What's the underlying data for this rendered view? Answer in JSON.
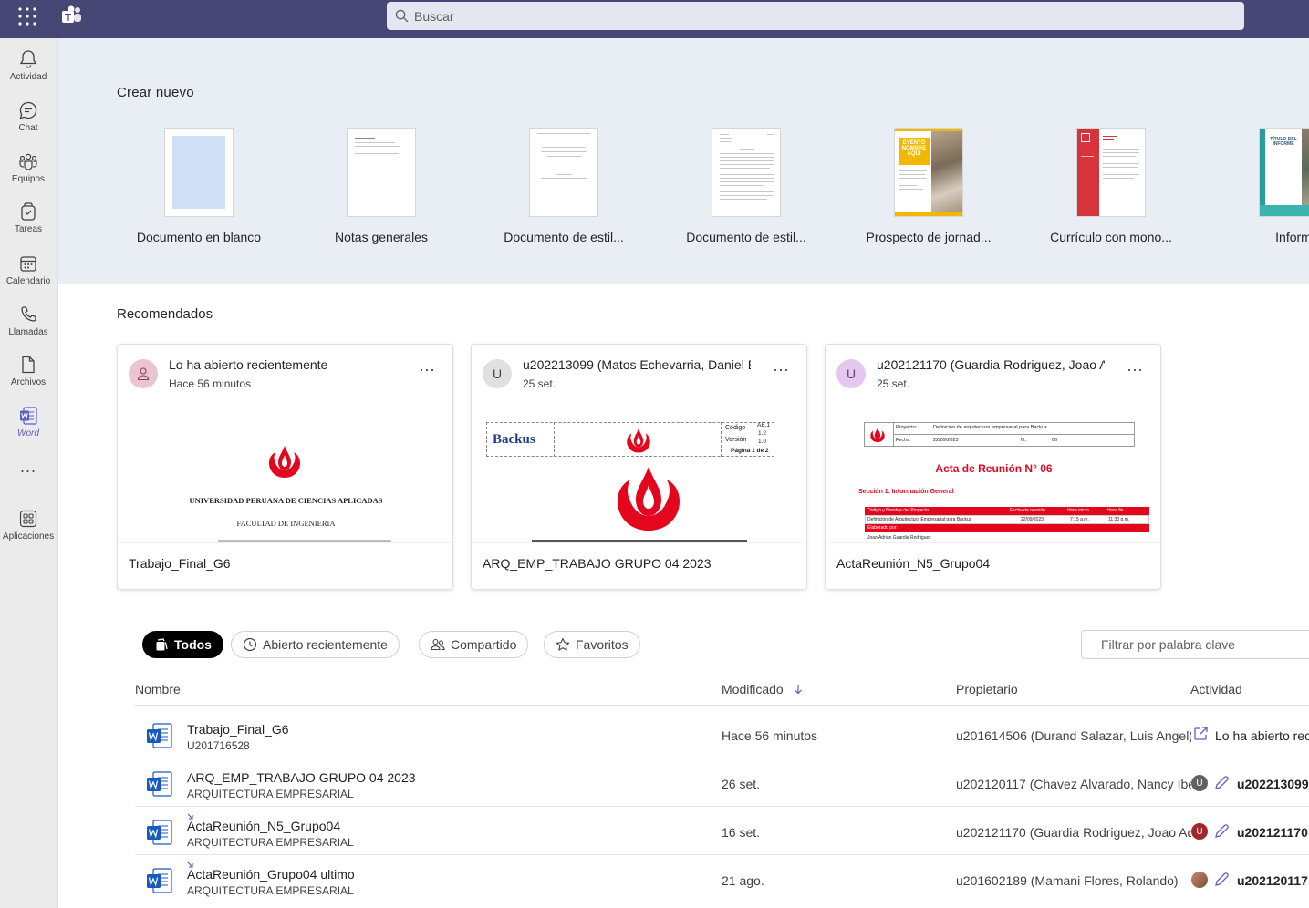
{
  "search": {
    "placeholder": "Buscar"
  },
  "rail": {
    "items": [
      {
        "label": "Actividad",
        "icon": "bell-icon"
      },
      {
        "label": "Chat",
        "icon": "chat-icon"
      },
      {
        "label": "Equipos",
        "icon": "teams-icon"
      },
      {
        "label": "Tareas",
        "icon": "tasks-icon"
      },
      {
        "label": "Calendario",
        "icon": "calendar-icon"
      },
      {
        "label": "Llamadas",
        "icon": "phone-icon"
      },
      {
        "label": "Archivos",
        "icon": "file-icon"
      },
      {
        "label": "Word",
        "icon": "word-icon",
        "active": true
      },
      {
        "label": "Aplicaciones",
        "icon": "apps-icon"
      }
    ],
    "more": "..."
  },
  "create_new": {
    "title": "Crear nuevo",
    "templates": [
      {
        "name": "Documento en blanco"
      },
      {
        "name": "Notas generales"
      },
      {
        "name": "Documento de estil..."
      },
      {
        "name": "Documento de estil..."
      },
      {
        "name": "Prospecto de jornad...",
        "thumb_text": "EVENTO NOMBRE AQUÍ"
      },
      {
        "name": "Currículo con mono..."
      },
      {
        "name": "Inform",
        "thumb_text": "TÍTULO DEL INFORME"
      }
    ]
  },
  "recommended": {
    "title": "Recomendados",
    "cards": [
      {
        "avatar": "",
        "who": "Lo ha abierto recientemente",
        "when": "Hace 56 minutos",
        "file": "Trabajo_Final_G6",
        "preview": {
          "line1": "UNIVERSIDAD PERUANA DE CIENCIAS APLICADAS",
          "line2": "FACULTAD DE INGENIERIA"
        }
      },
      {
        "avatar": "U",
        "who": "u202213099 (Matos Echevarria, Daniel Er",
        "when": "25 set.",
        "file": "ARQ_EMP_TRABAJO GRUPO 04 2023",
        "preview": {
          "brand": "Backus",
          "f1": "Código",
          "f2": "Versión",
          "f3": "Página 1 de 2",
          "v1": "AE.1",
          "v2": "1.2",
          "v3": "1.0"
        }
      },
      {
        "avatar": "U",
        "who": "u202121170 (Guardia Rodriguez, Joao Ad",
        "when": "25 set.",
        "file": "ActaReunión_N5_Grupo04",
        "preview": {
          "heading": "Acta de Reunión N° 06",
          "section": "Sección 1. Información General",
          "k1": "Proyecto:",
          "v1": "Definición de arquitectura empresarial para Backus",
          "k2": "Fecha:",
          "v2": "22/09/2023",
          "k3": "N.:",
          "v3": "06",
          "th1": "Código y Nombre del Proyecto",
          "th2": "Fecha de reunión",
          "th3": "Hora inicio",
          "th4": "Hora fin",
          "td1": "Definición de Arquitectura Empresarial para Backus",
          "td2": "22/09/2023",
          "td3": "7:15 a.m.",
          "td4": "11:30 p.m.",
          "elab": "Elaborado por:",
          "elab_name": "Joao Adrian Guardia Rodriguez"
        }
      }
    ]
  },
  "filters": {
    "chips": [
      {
        "label": "Todos",
        "active": true
      },
      {
        "label": "Abierto recientemente"
      },
      {
        "label": "Compartido"
      },
      {
        "label": "Favoritos"
      }
    ],
    "keyword_placeholder": "Filtrar por palabra clave"
  },
  "table": {
    "headers": {
      "name": "Nombre",
      "modified": "Modificado",
      "owner": "Propietario",
      "activity": "Actividad"
    },
    "rows": [
      {
        "name": "Trabajo_Final_G6",
        "sub": "U201716528",
        "modified": "Hace 56 minutos",
        "owner": "u201614506 (Durand Salazar, Luis Angel)",
        "activity": "Lo ha abierto rec"
      },
      {
        "name": "ARQ_EMP_TRABAJO GRUPO 04 2023",
        "sub": "ARQUITECTURA EMPRESARIAL",
        "modified": "26 set.",
        "owner": "u202120117 (Chavez Alvarado, Nancy Ibe",
        "activity_avatar": "U",
        "activity": "u202213099"
      },
      {
        "name": "ActaReunión_N5_Grupo04",
        "sub": "ARQUITECTURA EMPRESARIAL",
        "modified": "16 set.",
        "owner": "u202121170 (Guardia Rodriguez, Joao Ad",
        "activity_avatar": "U",
        "activity": "u202121170"
      },
      {
        "name": "ActaReunión_Grupo04 ultimo",
        "sub": "ARQUITECTURA EMPRESARIAL",
        "modified": "21 ago.",
        "owner": "u201602189 (Mamani Flores, Rolando)",
        "activity": "u202120117"
      }
    ]
  },
  "colors": {
    "topbar": "#464775",
    "rail": "#ebebeb",
    "accent": "#5b5fc7",
    "upc_red": "#e3061d",
    "word_blue": "#185abd"
  }
}
